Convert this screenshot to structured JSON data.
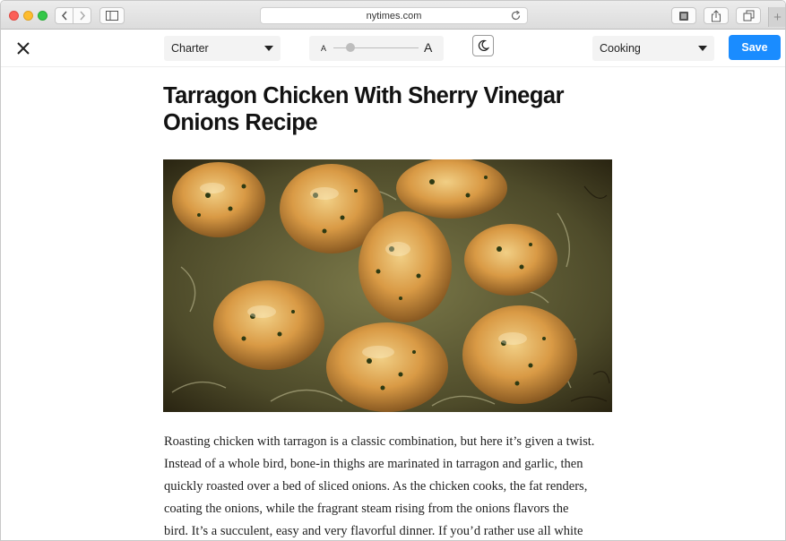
{
  "browser": {
    "url": "nytimes.com",
    "new_tab_label": "+"
  },
  "reader_toolbar": {
    "font_value": "Charter",
    "size_small_label": "A",
    "size_large_label": "A",
    "text_size_level": 0.2,
    "section_value": "Cooking",
    "save_label": "Save",
    "accent_color": "#1a8cff"
  },
  "article": {
    "title": "Tarragon Chicken With Sherry Vinegar Onions Recipe",
    "body_lines": [
      "Roasting chicken with tarragon is a classic combination, but here it’s given a twist.",
      "Instead of a whole bird, bone-in thighs are marinated in tarragon and garlic, then",
      "quickly roasted over a bed of sliced onions. As the chicken cooks, the fat renders,",
      "coating the onions, while the fragrant steam rising from the onions flavors the",
      "bird. It’s a succulent, easy and very flavorful dinner. If you’d rather use all white"
    ]
  },
  "icons": {
    "close": "close-icon",
    "back": "chevron-left-icon",
    "forward": "chevron-right-icon",
    "sidebar": "sidebar-icon",
    "reload": "reload-icon",
    "reader": "reader-icon",
    "share": "share-icon",
    "tabs": "tabs-icon",
    "night": "moon-icon"
  }
}
